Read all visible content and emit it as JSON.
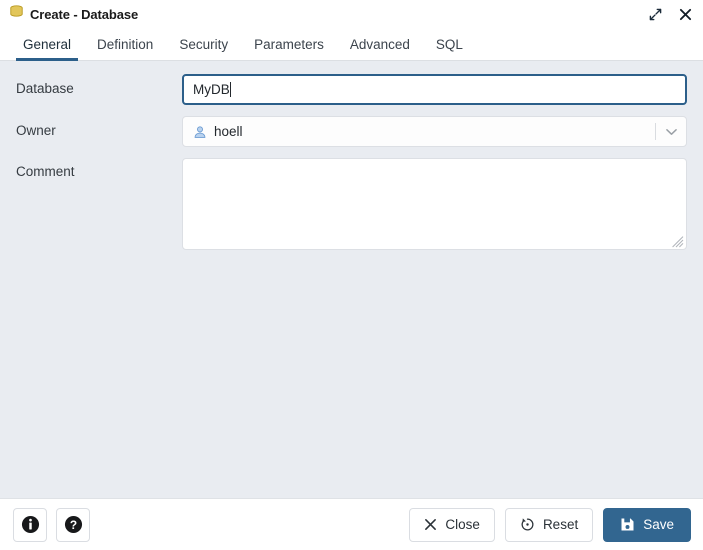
{
  "window": {
    "title": "Create - Database",
    "icon": "database-icon",
    "controls": [
      {
        "name": "expand-icon",
        "label": "Expand"
      },
      {
        "name": "close-icon",
        "label": "Close"
      }
    ]
  },
  "tabs": {
    "active": "General",
    "items": [
      {
        "label": "General",
        "active": true
      },
      {
        "label": "Definition",
        "active": false
      },
      {
        "label": "Security",
        "active": false
      },
      {
        "label": "Parameters",
        "active": false
      },
      {
        "label": "Advanced",
        "active": false
      },
      {
        "label": "SQL",
        "active": false
      }
    ]
  },
  "form": {
    "database": {
      "label": "Database",
      "value": "MyDB",
      "placeholder": "",
      "focused": true,
      "spellcheck_error": true
    },
    "owner": {
      "label": "Owner",
      "value": "hoell",
      "icon": "user-icon",
      "dropdown_icon": "chevron-down-icon"
    },
    "comment": {
      "label": "Comment",
      "value": "",
      "placeholder": ""
    }
  },
  "footer": {
    "info_button": {
      "label": "Information",
      "icon": "info-icon"
    },
    "help_button": {
      "label": "Help",
      "icon": "help-icon"
    },
    "close_button": {
      "label": "Close",
      "icon": "close-x-icon"
    },
    "reset_button": {
      "label": "Reset",
      "icon": "reset-icon"
    },
    "save_button": {
      "label": "Save",
      "icon": "save-floppy-icon"
    }
  },
  "colors": {
    "accent": "#326690",
    "tab_active_underline": "#2c5f8a",
    "input_focus_border": "#2c5f8a",
    "form_background": "#e9ecf1",
    "spellcheck_underline": "#e03a2f",
    "db_icon": "#d8b63a",
    "user_icon": "#7aa6d8"
  }
}
